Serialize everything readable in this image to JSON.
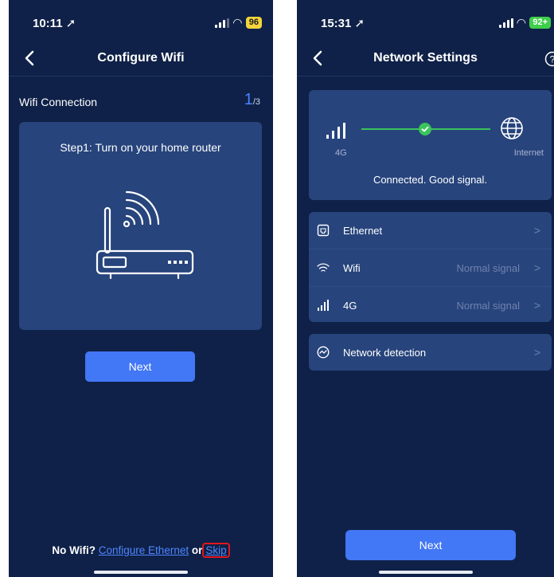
{
  "screen1": {
    "status": {
      "time": "10:11",
      "battery": "96"
    },
    "title": "Configure Wifi",
    "section_label": "Wifi Connection",
    "step_current": "1",
    "step_total": "/3",
    "step_text": "Step1: Turn on your home router",
    "next_label": "Next",
    "footer": {
      "prefix": "No Wifi?",
      "link_ethernet": "Configure Ethernet",
      "or": "or",
      "link_skip": "Skip"
    }
  },
  "screen2": {
    "status": {
      "time": "15:31",
      "battery": "92+"
    },
    "title": "Network Settings",
    "conn": {
      "left_label": "4G",
      "right_label": "Internet",
      "status_text": "Connected. Good signal."
    },
    "rows": [
      {
        "label": "Ethernet",
        "value": "",
        "icon": "ethernet-icon"
      },
      {
        "label": "Wifi",
        "value": "Normal signal",
        "icon": "wifi-icon"
      },
      {
        "label": "4G",
        "value": "Normal signal",
        "icon": "cellular-signal-icon"
      }
    ],
    "detection_label": "Network detection",
    "next_label": "Next"
  },
  "colors": {
    "background": "#0f2148",
    "card": "#27447c",
    "accent": "#4277f5",
    "success": "#3bc35c",
    "highlight": "#e0171f"
  }
}
